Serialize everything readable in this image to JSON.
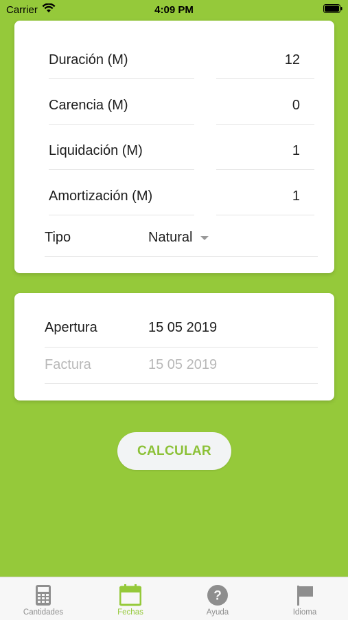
{
  "status_bar": {
    "carrier": "Carrier",
    "time": "4:09 PM"
  },
  "loan_card": {
    "rows": [
      {
        "label": "Duración (M)",
        "value": "12"
      },
      {
        "label": "Carencia (M)",
        "value": "0"
      },
      {
        "label": "Liquidación (M)",
        "value": "1"
      },
      {
        "label": "Amortización (M)",
        "value": "1"
      }
    ],
    "tipo": {
      "label": "Tipo",
      "selected": "Natural"
    }
  },
  "dates_card": {
    "apertura": {
      "label": "Apertura",
      "value": "15 05 2019"
    },
    "factura": {
      "label": "Factura",
      "value": "15 05 2019"
    }
  },
  "calculate_label": "CALCULAR",
  "tab_bar": {
    "tabs": [
      {
        "label": "Cantidades",
        "icon": "calculator-icon"
      },
      {
        "label": "Fechas",
        "icon": "calendar-icon"
      },
      {
        "label": "Ayuda",
        "icon": "help-icon"
      },
      {
        "label": "Idioma",
        "icon": "flag-icon"
      }
    ],
    "active": "Fechas"
  },
  "colors": {
    "accent": "#95c93a",
    "card": "#ffffff",
    "muted_text": "#b8b8b8",
    "tab_inactive": "#8e8e8e"
  }
}
